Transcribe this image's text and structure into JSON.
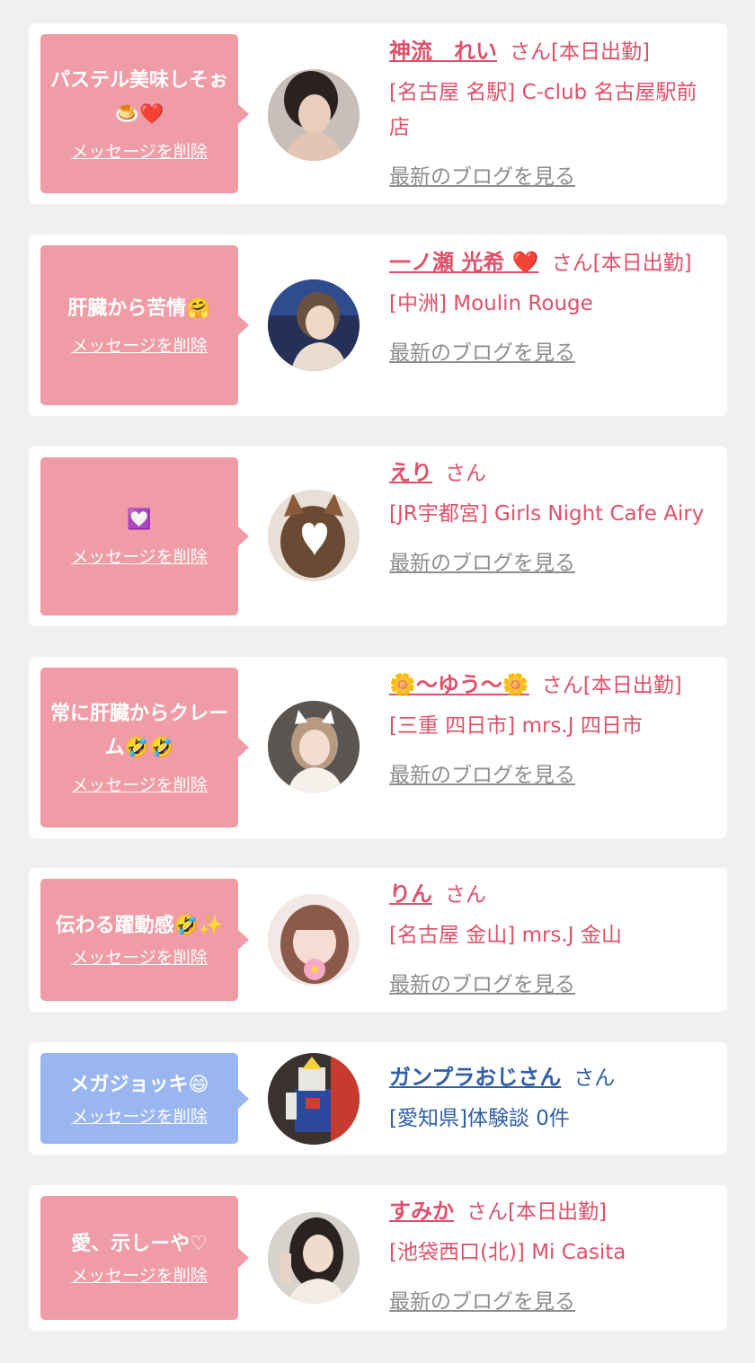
{
  "ui": {
    "delete_label": "メッセージを削除",
    "blog_label": "最新のブログを見る"
  },
  "colors": {
    "page_bg": "#f0f0f0",
    "card_bg": "#ffffff",
    "bubble_pink": "#f09ca6",
    "bubble_blue": "#9ab6f0",
    "name_pink": "#e0506a",
    "name_blue": "#2f5fa7",
    "blog_gray": "#8e8e8e"
  },
  "items": [
    {
      "message": "パステル美味しそぉ🍮❤️",
      "name": "神流　れい",
      "suffix": "さん[本日出勤]",
      "shop": "[名古屋 名駅] C-club 名古屋駅前店",
      "has_blog": true,
      "theme": "pink"
    },
    {
      "message": "肝臓から苦情🤗",
      "name": "一ノ瀬 光希 ❤️",
      "suffix": "さん[本日出勤]",
      "shop": "[中洲] Moulin Rouge",
      "has_blog": true,
      "theme": "pink"
    },
    {
      "message": "💟",
      "name": "えり",
      "suffix": "さん",
      "shop": "[JR宇都宮] Girls Night Cafe Airy",
      "has_blog": true,
      "theme": "pink"
    },
    {
      "message": "常に肝臓からクレーム🤣🤣",
      "name": "🌼〜ゆう〜🌼",
      "suffix": "さん[本日出勤]",
      "shop": "[三重 四日市] mrs.J 四日市",
      "has_blog": true,
      "theme": "pink"
    },
    {
      "message": "伝わる躍動感🤣✨",
      "name": "りん",
      "suffix": "さん",
      "shop": "[名古屋 金山] mrs.J 金山",
      "has_blog": true,
      "theme": "pink"
    },
    {
      "message": "メガジョッキ😄",
      "name": "ガンプラおじさん",
      "suffix": "さん",
      "shop": "[愛知県]体験談 0件",
      "has_blog": false,
      "theme": "blue"
    },
    {
      "message": "愛、示しーや♡",
      "name": "すみか",
      "suffix": "さん[本日出勤]",
      "shop": "[池袋西口(北)] Mi Casita",
      "has_blog": true,
      "theme": "pink"
    }
  ]
}
